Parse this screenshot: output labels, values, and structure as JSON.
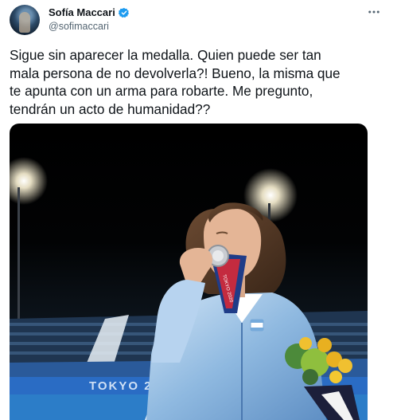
{
  "author": {
    "name": "Sofía Maccari",
    "handle": "@sofimaccari",
    "verified": true
  },
  "more_icon": "more-horizontal-icon",
  "tweet_lines": [
    "Sigue sin aparecer la medalla. Quien puede ser tan",
    "mala persona de no devolverla?! Bueno, la misma que",
    "te apunta con un arma para robarte. Me pregunto,",
    "tendrán un acto de humanidad??"
  ],
  "media": {
    "banner_text": "TOKYO 2020",
    "ribbon_text": "TOKYO 2020"
  },
  "colors": {
    "verified": "#1d9bf0",
    "text": "#0f1419",
    "secondary": "#536471"
  }
}
